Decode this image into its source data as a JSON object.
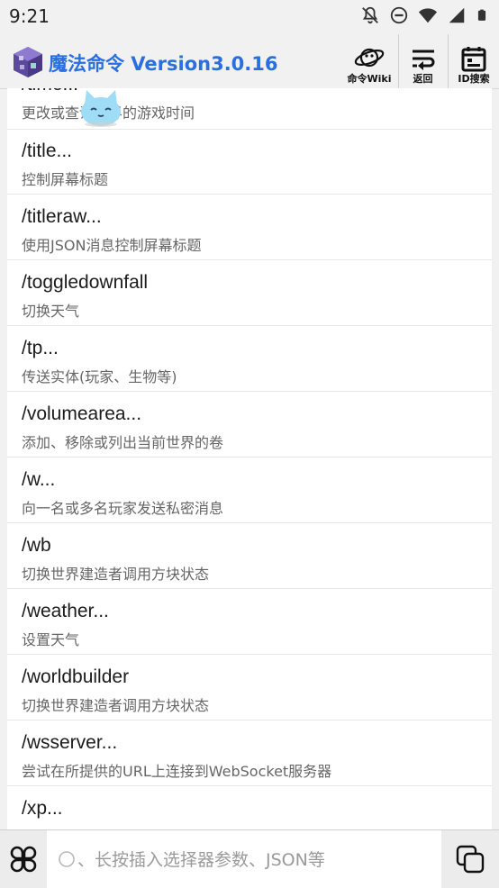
{
  "status": {
    "time": "9:21"
  },
  "header": {
    "title": "魔法命令 Version3.0.16",
    "wiki_label": "命令Wiki",
    "back_label": "返回",
    "id_search_label": "ID搜索"
  },
  "commands": [
    {
      "cmd": "/time...",
      "desc": "更改或查询世界的游戏时间"
    },
    {
      "cmd": "/title...",
      "desc": "控制屏幕标题"
    },
    {
      "cmd": "/titleraw...",
      "desc": "使用JSON消息控制屏幕标题"
    },
    {
      "cmd": "/toggledownfall",
      "desc": "切换天气"
    },
    {
      "cmd": "/tp...",
      "desc": "传送实体(玩家、生物等)"
    },
    {
      "cmd": "/volumearea...",
      "desc": "添加、移除或列出当前世界的卷"
    },
    {
      "cmd": "/w...",
      "desc": "向一名或多名玩家发送私密消息"
    },
    {
      "cmd": "/wb",
      "desc": "切换世界建造者调用方块状态"
    },
    {
      "cmd": "/weather...",
      "desc": "设置天气"
    },
    {
      "cmd": "/worldbuilder",
      "desc": "切换世界建造者调用方块状态"
    },
    {
      "cmd": "/wsserver...",
      "desc": "尝试在所提供的URL上连接到WebSocket服务器"
    },
    {
      "cmd": "/xp...",
      "desc": ""
    }
  ],
  "input": {
    "placeholder": "、长按插入选择器参数、JSON等"
  }
}
